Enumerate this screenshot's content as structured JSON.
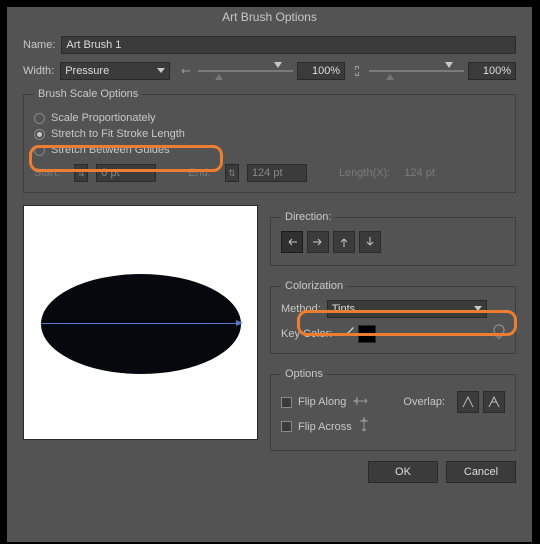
{
  "title": "Art Brush Options",
  "name_label": "Name:",
  "name_value": "Art Brush 1",
  "width_label": "Width:",
  "width_mode": "Pressure",
  "width_min": "100%",
  "width_max": "100%",
  "brushscale": {
    "legend": "Brush Scale Options",
    "opt_proportional": "Scale Proportionately",
    "opt_stretch": "Stretch to Fit Stroke Length",
    "opt_guides": "Stretch Between Guides",
    "start_label": "Start:",
    "start_value": "0 pt",
    "end_label": "End:",
    "end_value": "124 pt",
    "lengthx_label": "Length(X):",
    "lengthx_value": "124 pt"
  },
  "direction": {
    "legend": "Direction:"
  },
  "colorization": {
    "legend": "Colorization",
    "method_label": "Method:",
    "method_value": "Tints",
    "keycolor_label": "Key Color:"
  },
  "options": {
    "legend": "Options",
    "flip_along": "Flip Along",
    "flip_across": "Flip Across",
    "overlap_label": "Overlap:"
  },
  "buttons": {
    "ok": "OK",
    "cancel": "Cancel"
  }
}
